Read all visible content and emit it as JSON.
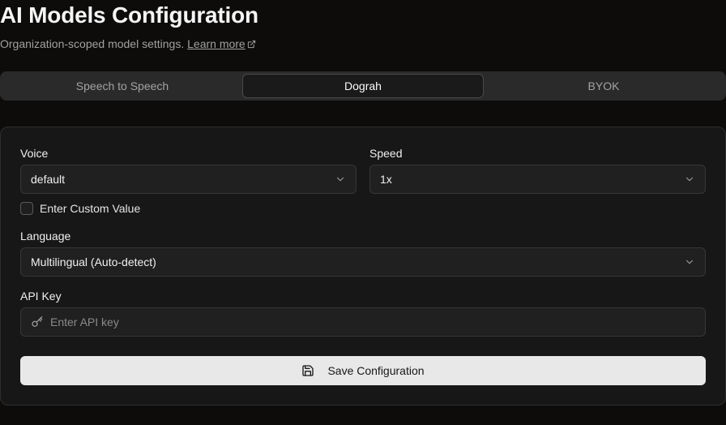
{
  "header": {
    "title": "AI Models Configuration",
    "subtitle": "Organization-scoped model settings.",
    "learn_more": "Learn more"
  },
  "tabs": [
    {
      "label": "Speech to Speech",
      "active": false
    },
    {
      "label": "Dograh",
      "active": true
    },
    {
      "label": "BYOK",
      "active": false
    }
  ],
  "form": {
    "voice": {
      "label": "Voice",
      "value": "default"
    },
    "speed": {
      "label": "Speed",
      "value": "1x"
    },
    "custom_value": {
      "label": "Enter Custom Value",
      "checked": false
    },
    "language": {
      "label": "Language",
      "value": "Multilingual (Auto-detect)"
    },
    "api_key": {
      "label": "API Key",
      "placeholder": "Enter API key",
      "value": ""
    },
    "save_label": "Save Configuration"
  },
  "icons": {
    "external_link": "external-link-icon",
    "chevron": "chevron-down-icon",
    "key": "key-icon",
    "save": "save-icon"
  }
}
